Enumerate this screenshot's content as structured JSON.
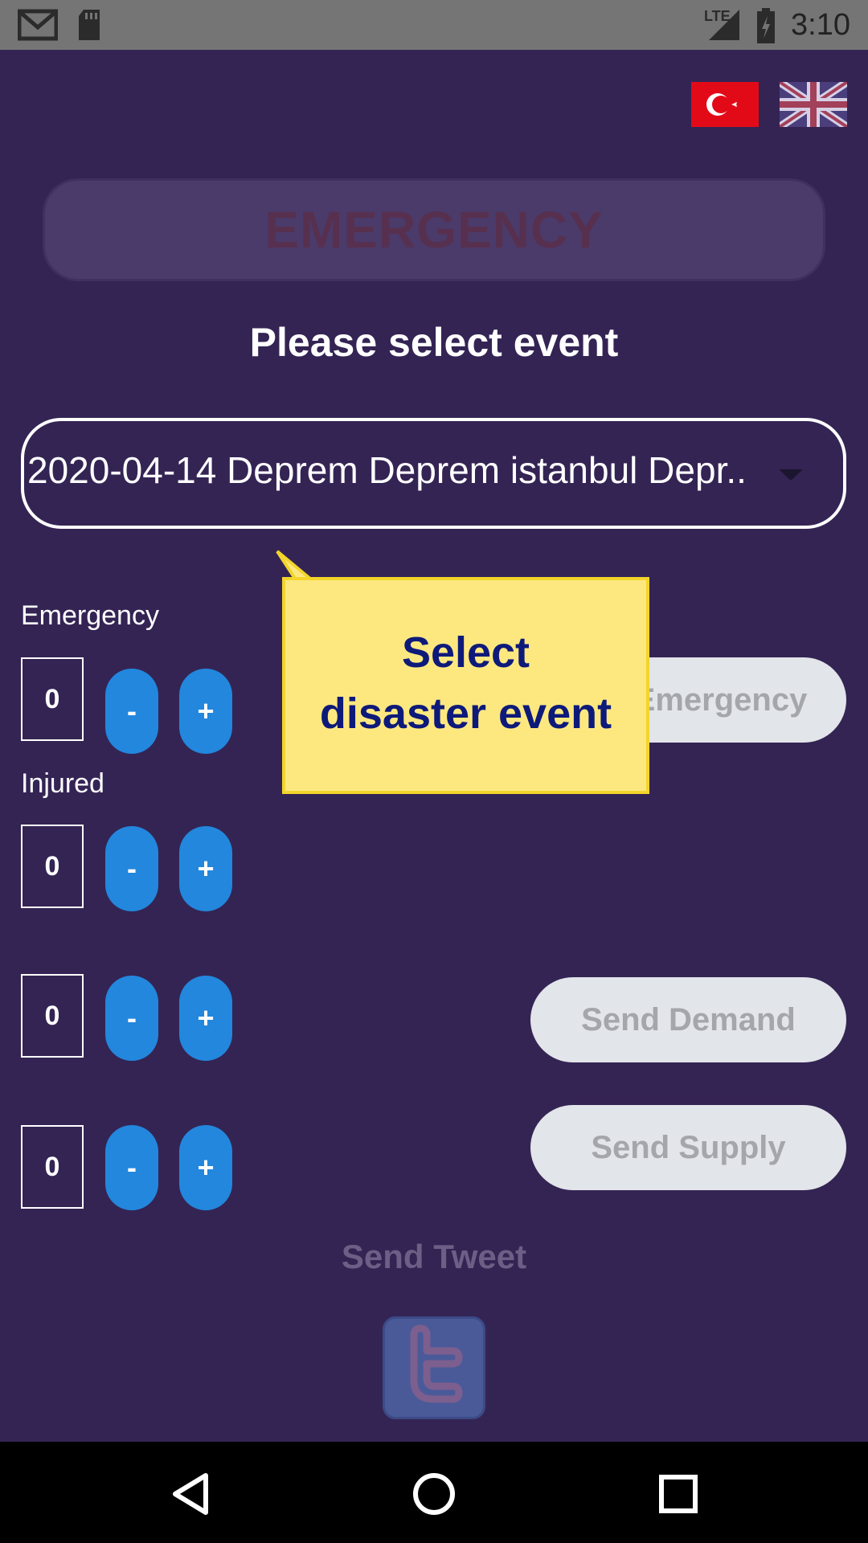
{
  "status_bar": {
    "time": "3:10",
    "network_label": "LTE",
    "icons": [
      "gmail-icon",
      "sd-card-icon",
      "signal-icon",
      "battery-charging-icon"
    ]
  },
  "language_flags": [
    {
      "name": "turkish-flag-icon"
    },
    {
      "name": "uk-flag-icon"
    }
  ],
  "emergency_banner": {
    "label": "EMERGENCY"
  },
  "event_section": {
    "title": "Please select event",
    "dropdown_value": "2020-04-14 Deprem Deprem istanbul Depr.."
  },
  "counters": [
    {
      "label": "Emergency",
      "value": "0",
      "minus": "-",
      "plus": "+"
    },
    {
      "label": "Injured",
      "value": "0",
      "minus": "-",
      "plus": "+"
    },
    {
      "label": "",
      "value": "0",
      "minus": "-",
      "plus": "+"
    },
    {
      "label": "",
      "value": "0",
      "minus": "-",
      "plus": "+"
    }
  ],
  "actions": {
    "send_emergency": "Emergency",
    "send_demand": "Send Demand",
    "send_supply": "Send Supply",
    "send_tweet": "Send Tweet"
  },
  "callout": {
    "line1": "Select",
    "line2": "disaster event"
  },
  "colors": {
    "background": "#342454",
    "stepper": "#2287dd",
    "callout_fill": "#fde880",
    "callout_text": "#0d1a7a"
  }
}
